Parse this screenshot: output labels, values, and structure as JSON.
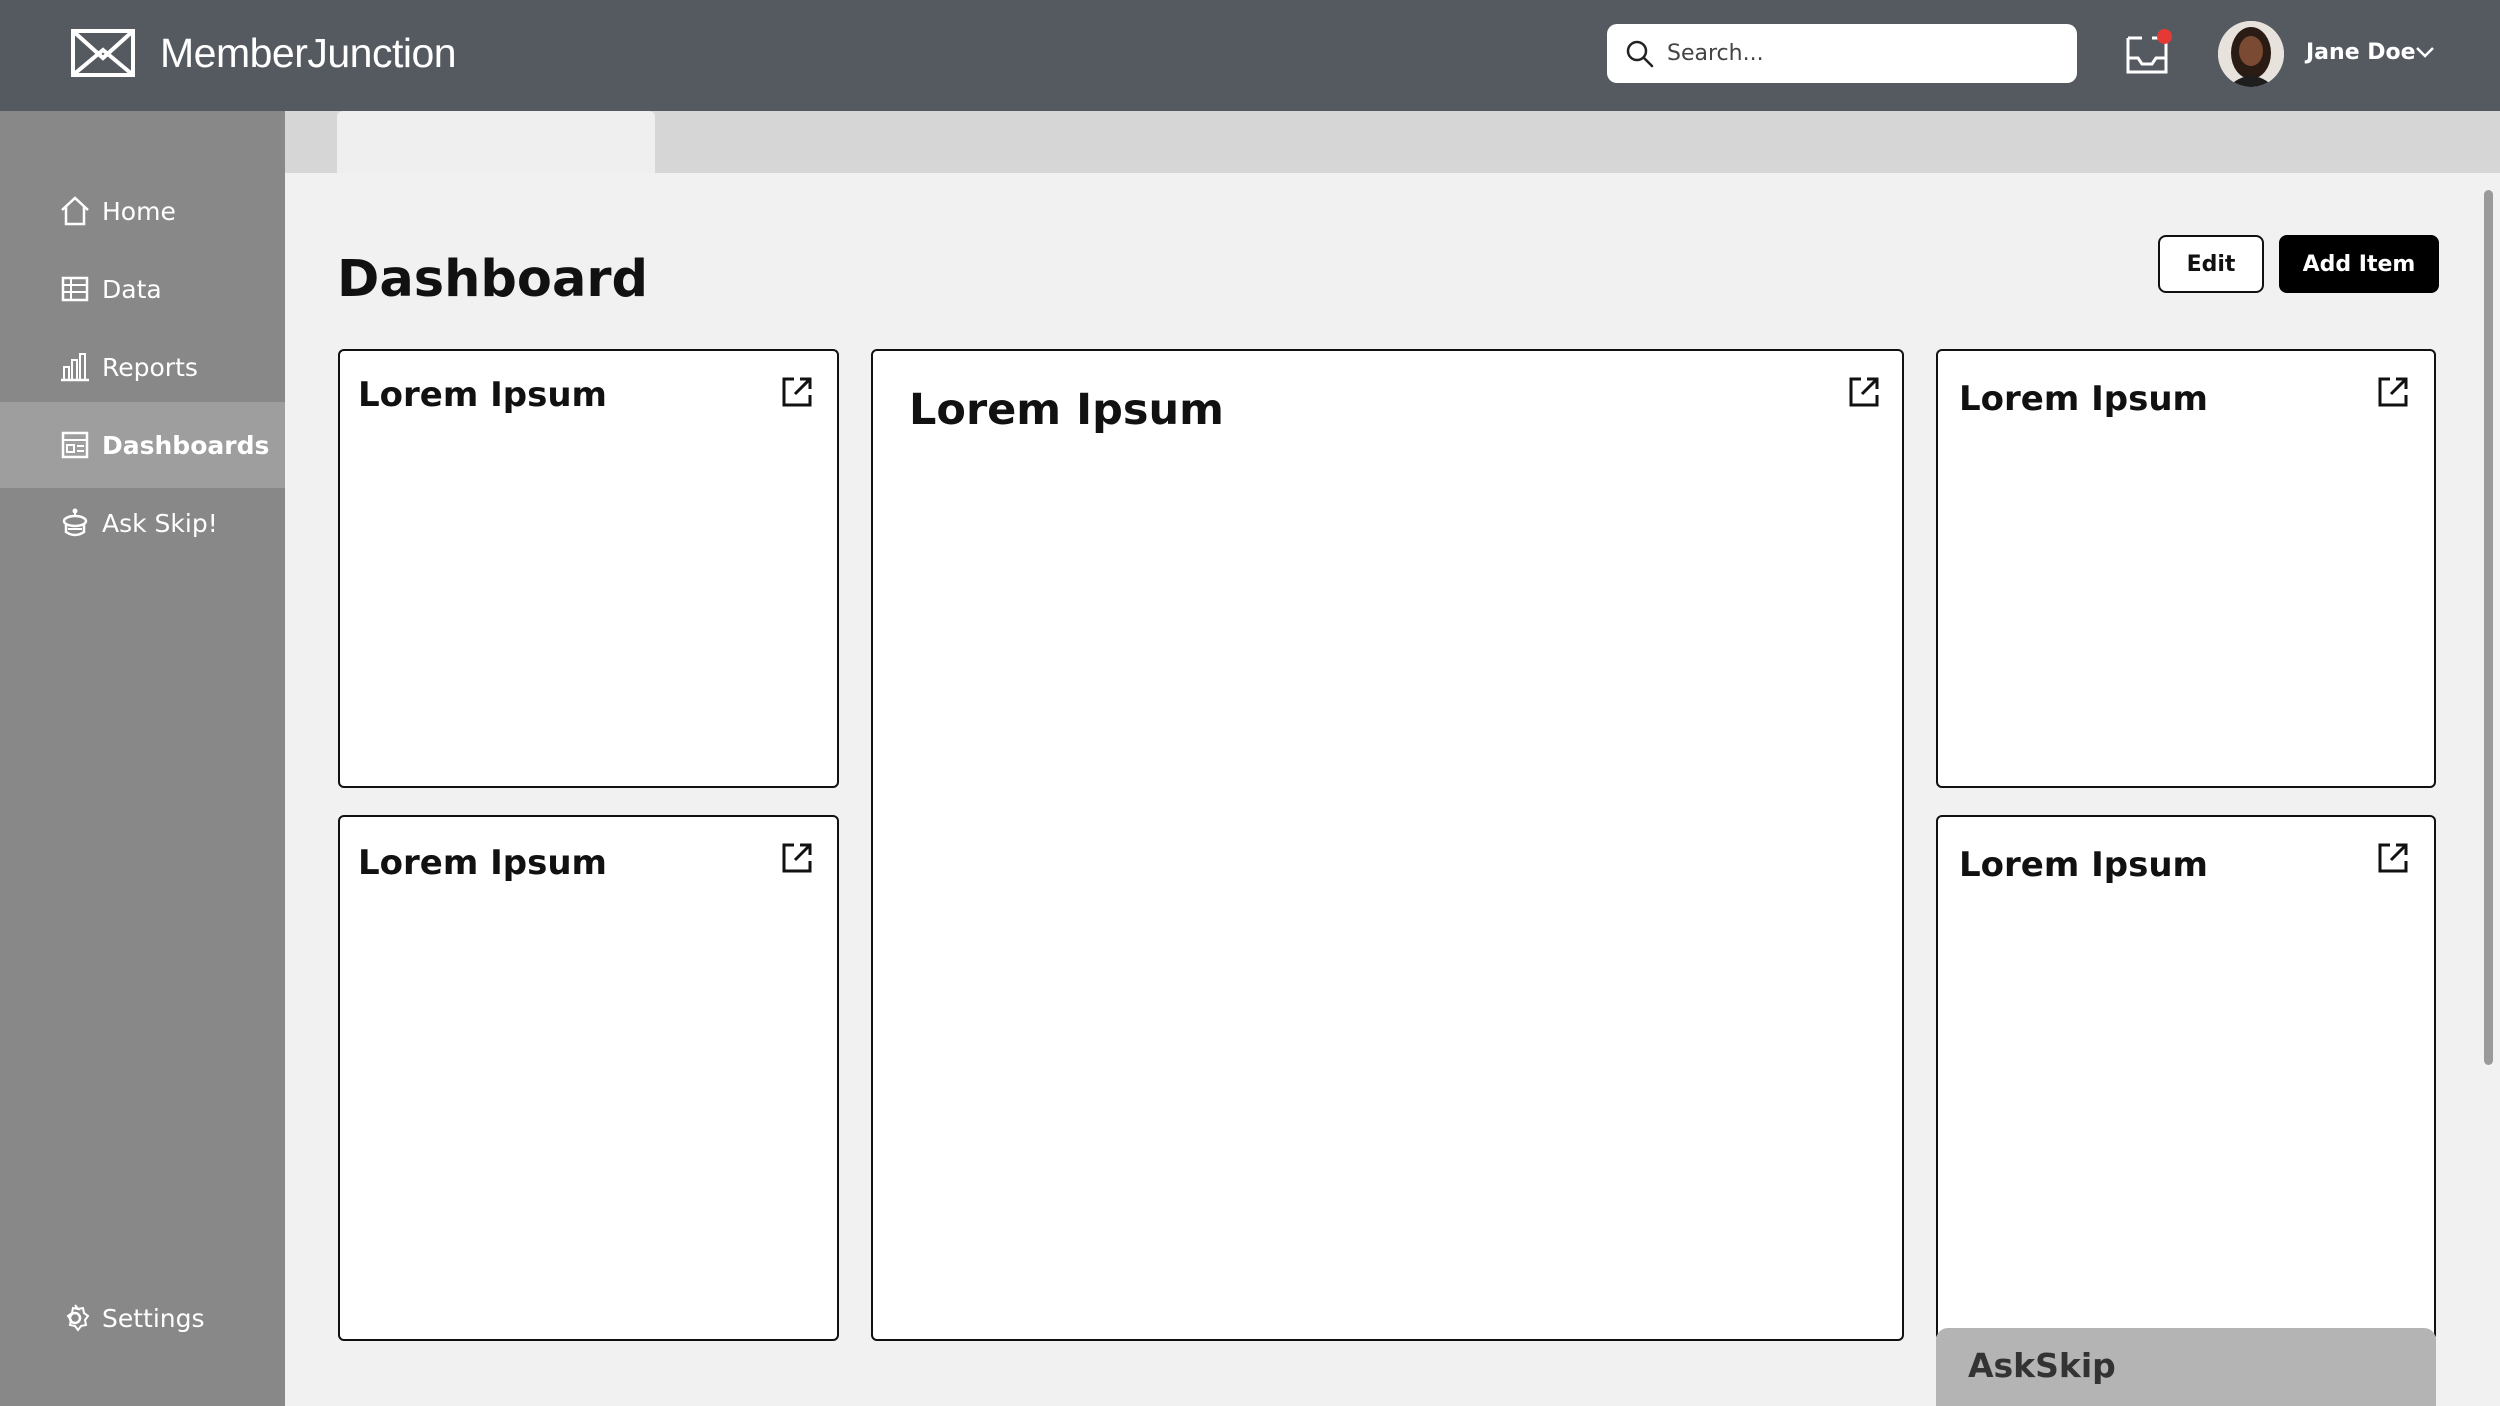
{
  "app": {
    "name": "MemberJunction"
  },
  "header": {
    "search_placeholder": "Search...",
    "notification_icon": "inbox-icon",
    "user_name": "Jane Doe"
  },
  "sidebar": {
    "items": [
      {
        "label": "Home",
        "icon": "home-icon",
        "active": false
      },
      {
        "label": "Data",
        "icon": "table-icon",
        "active": false
      },
      {
        "label": "Reports",
        "icon": "bar-chart-icon",
        "active": false
      },
      {
        "label": "Dashboards",
        "icon": "dashboard-icon",
        "active": true
      },
      {
        "label": "Ask Skip!",
        "icon": "skip-robot-icon",
        "active": false
      }
    ],
    "settings_label": "Settings"
  },
  "main": {
    "title": "Dashboard",
    "edit_label": "Edit",
    "add_label": "Add Item",
    "cards": [
      {
        "title": "Lorem Ipsum"
      },
      {
        "title": "Lorem Ipsum"
      },
      {
        "title": "Lorem Ipsum"
      },
      {
        "title": "Lorem Ipsum"
      },
      {
        "title": "Lorem Ipsum"
      }
    ]
  },
  "askskip": {
    "label": "AskSkip"
  },
  "colors": {
    "header_bg": "#555a60",
    "sidebar_bg": "#888888",
    "sidebar_active_bg": "#9e9e9e",
    "content_bg": "#f1f1f1",
    "notification_dot": "#e53935"
  }
}
